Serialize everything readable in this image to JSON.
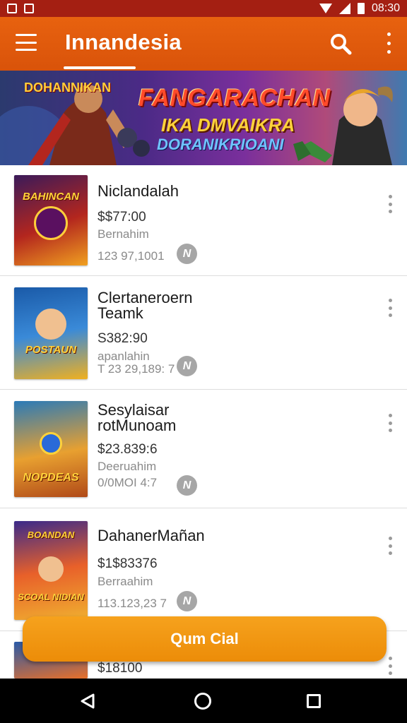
{
  "status_bar": {
    "time": "08:30"
  },
  "app_bar": {
    "title": "Innandesia"
  },
  "banner": {
    "line1": "FANGARACHAN",
    "line2": "IKA DMVAIKRA",
    "line3": "DORANIKRIOANI",
    "logo_text": "DOHANNIKAN"
  },
  "games": [
    {
      "title_lines": [
        "Niclandalah"
      ],
      "price": "$$77:00",
      "developer": "Bernahim",
      "count": "123 97,1001",
      "thumb_text": "BAHINCAN",
      "install_glyph": "N"
    },
    {
      "title_lines": [
        "Clertaneroern",
        "Teamk"
      ],
      "price": "S382:90",
      "developer": "apanlahin",
      "count": "T 23 29,189: 7",
      "thumb_text": "POSTAUN",
      "install_glyph": "N"
    },
    {
      "title_lines": [
        "Sesylaisar",
        "rotMunoam"
      ],
      "price": "$23.839:6",
      "developer": "Deeruahim",
      "count": "0/0MOI 4:7",
      "thumb_text": "NOPDEAS",
      "install_glyph": "N"
    },
    {
      "title_lines": [
        "DahanerMañan"
      ],
      "price": "$1$83376",
      "developer": "Berraahim",
      "count": "113.123,23 7",
      "thumb_text": "SCOAL NIDIAN",
      "install_glyph": "N"
    },
    {
      "title_lines": [
        ""
      ],
      "price": "$18100",
      "developer": "",
      "count": "",
      "thumb_text": "",
      "install_glyph": ""
    }
  ],
  "fab": {
    "label": "Qum Cial"
  },
  "colors": {
    "app_bar": "#e05a0c",
    "status_bar": "#a41f12",
    "fab": "#f19716",
    "install_icon": "#a6a6a6"
  }
}
